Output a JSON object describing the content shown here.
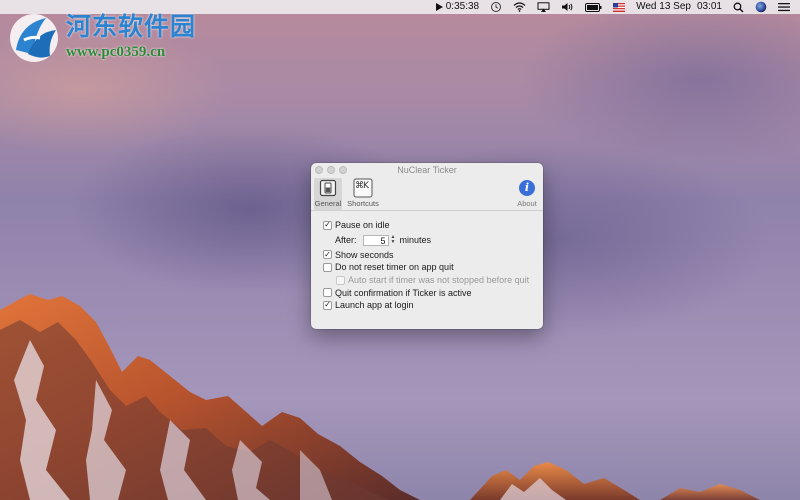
{
  "menubar": {
    "timer": "0:35:38",
    "icons": [
      "play-icon",
      "time-machine-icon",
      "wifi-icon",
      "airplay-icon",
      "volume-icon",
      "battery-icon",
      "flag-icon",
      "search-icon",
      "siri-icon",
      "menu-icon"
    ],
    "datetime": "Wed 13 Sep",
    "clock": "03:01"
  },
  "watermark": {
    "title": "河东软件园",
    "url": "www.pc0359.cn"
  },
  "window": {
    "title": "NuClear Ticker",
    "toolbar": {
      "general": "General",
      "shortcuts": "Shortcuts",
      "about": "About",
      "about_glyph": "i",
      "shortcut_glyphs": "⌘K"
    },
    "options": {
      "pause_on_idle": {
        "label": "Pause on idle",
        "checked": true
      },
      "after_label": "After:",
      "after_value": "5",
      "after_unit": "minutes",
      "show_seconds": {
        "label": "Show seconds",
        "checked": true
      },
      "no_reset": {
        "label": "Do not reset timer on app quit",
        "checked": false
      },
      "auto_start": {
        "label": "Auto start if timer was not stopped before quit",
        "checked": false,
        "enabled": false
      },
      "quit_confirm": {
        "label": "Quit confirmation if Ticker is active",
        "checked": false
      },
      "launch_login": {
        "label": "Launch app at login",
        "checked": true
      }
    },
    "checkmark": "✓"
  },
  "colors": {
    "watermark_title": "#2c83cf",
    "watermark_url": "#2b8a35",
    "about_icon": "#3b6fd8"
  }
}
